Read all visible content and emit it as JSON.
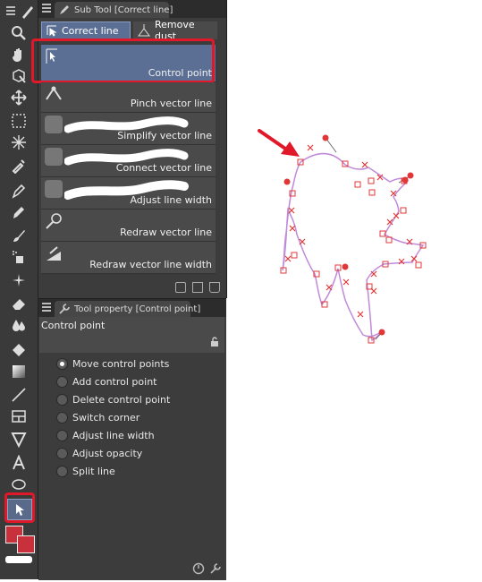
{
  "sub_tool": {
    "title": "Sub Tool [Correct line]",
    "group_tabs": [
      "Correct line",
      "Remove dust"
    ],
    "items": [
      {
        "label": "Control point",
        "icon": "control-point-icon",
        "active": true
      },
      {
        "label": "Pinch vector line",
        "icon": "pinch-icon"
      },
      {
        "label": "Simplify vector line",
        "icon": "simplify-icon"
      },
      {
        "label": "Connect vector line",
        "icon": "connect-icon"
      },
      {
        "label": "Adjust line width",
        "icon": "adjust-width-icon"
      },
      {
        "label": "Redraw vector line",
        "icon": "redraw-icon"
      },
      {
        "label": "Redraw vector line width",
        "icon": "redraw-width-icon"
      }
    ]
  },
  "tool_property": {
    "title": "Tool property [Control point]",
    "tool_name": "Control point",
    "options": [
      {
        "label": "Move control points",
        "selected": true
      },
      {
        "label": "Add control point"
      },
      {
        "label": "Delete control point"
      },
      {
        "label": "Switch corner"
      },
      {
        "label": "Adjust line width"
      },
      {
        "label": "Adjust opacity"
      },
      {
        "label": "Split line"
      }
    ]
  },
  "colors": {
    "highlight": "#e0182a",
    "main_color": "#c8303c",
    "sub_color": "#c8303c",
    "line_color": "#c08ad8",
    "point_color": "#e03838"
  }
}
